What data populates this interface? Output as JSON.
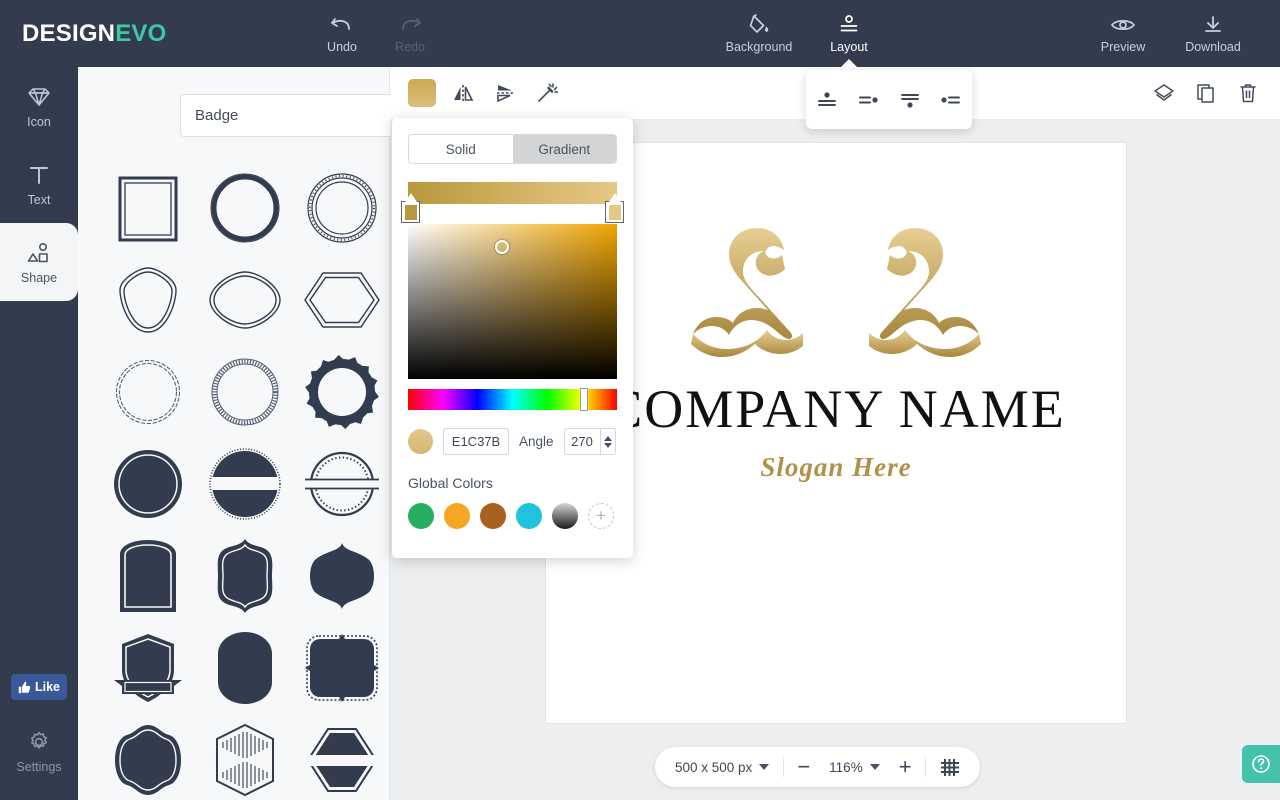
{
  "brand": {
    "part1": "DESIGN",
    "part2": "EVO",
    "accent": "#3fc8a6"
  },
  "topbar": {
    "undo": "Undo",
    "redo": "Redo",
    "background": "Background",
    "layout": "Layout",
    "preview": "Preview",
    "download": "Download"
  },
  "rail": {
    "items": [
      {
        "label": "Icon",
        "icon": "diamond-icon"
      },
      {
        "label": "Text",
        "icon": "text-icon"
      },
      {
        "label": "Shape",
        "icon": "shape-icon"
      }
    ],
    "like_label": "Like",
    "settings_label": "Settings"
  },
  "panel": {
    "category": "Badge",
    "shapes": [
      "square-double-frame",
      "circle-thick-ring",
      "circle-dotted-ring",
      "hexagon-rounded-outline",
      "diamond-rounded-outline",
      "hexagon-wide-outline",
      "circle-scallop-bead-outline",
      "circle-rope-outline",
      "circle-gear-solid",
      "circle-scallop-solid",
      "circle-banner-split-solid",
      "circle-split-ribbon-outline",
      "rect-arch-solid",
      "ornate-frame-solid",
      "pointed-oval-solid",
      "shield-ribbon-solid",
      "oval-octagon-solid",
      "square-ornate-solid",
      "quatrefoil-solid",
      "hexagon-striped-outline",
      "hexagon-banner-solid"
    ]
  },
  "canvas_toolbar": {
    "left": [
      "fill-color-swatch",
      "flip-horizontal-icon",
      "flip-vertical-icon",
      "magic-wand-icon"
    ],
    "right": [
      "layers-icon",
      "duplicate-icon",
      "delete-icon"
    ]
  },
  "layout_popup": {
    "options": [
      "align-top-icon",
      "align-right-icon",
      "align-bottom-icon",
      "align-left-icon"
    ]
  },
  "color_picker": {
    "mode_solid": "Solid",
    "mode_gradient": "Gradient",
    "active_mode": "Gradient",
    "hex_value": "E1C37B",
    "angle_label": "Angle",
    "angle_value": "270",
    "gradient_start": "#B9983F",
    "gradient_end": "#E6C888",
    "global_colors_label": "Global Colors",
    "global_colors": [
      "#27ae60",
      "#f5a623",
      "#a9611f",
      "#22c1dd",
      "#555555"
    ],
    "add_color_label": "+"
  },
  "artboard": {
    "company_name": "COMPANY NAME",
    "slogan": "Slogan Here",
    "logo_icon": "twin-swans-icon",
    "logo_color_top": "#e7cf93",
    "logo_color_bottom": "#a8873e"
  },
  "zoombar": {
    "size": "500 x 500 px",
    "zoom": "116%",
    "minus": "−",
    "plus": "+",
    "grid_icon": "grid-icon"
  },
  "help": {
    "icon": "help-question-icon"
  }
}
